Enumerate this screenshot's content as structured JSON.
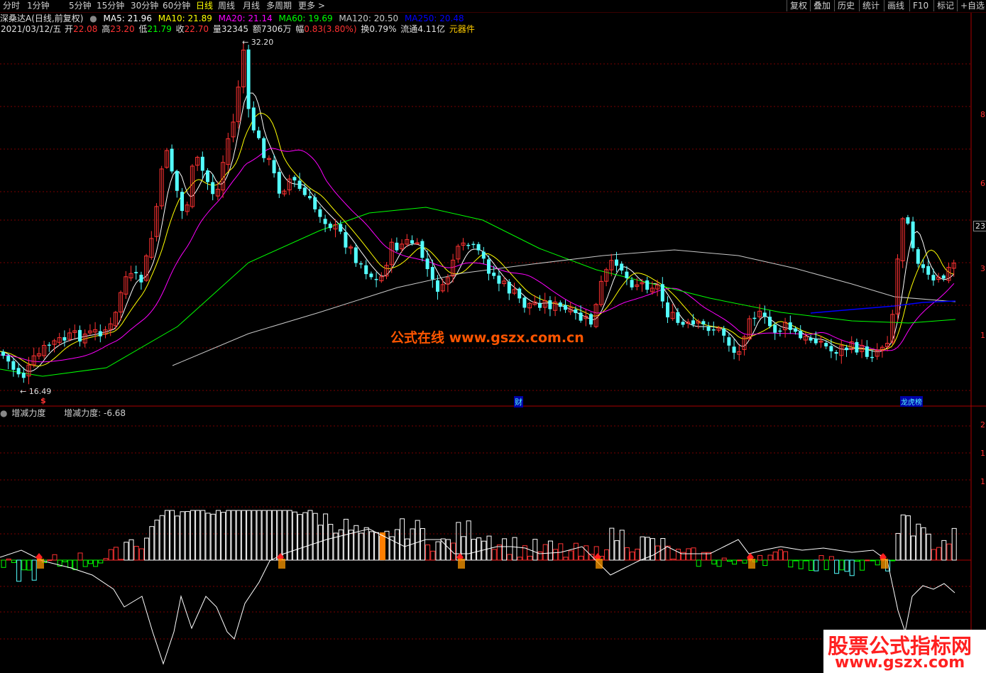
{
  "toolbar": {
    "periods": [
      "分时",
      "1分钟",
      "5分钟",
      "15分钟",
      "30分钟",
      "60分钟",
      "日线",
      "周线",
      "月线",
      "多周期",
      "更多 >"
    ],
    "active_period": "日线",
    "right_buttons": [
      "复权",
      "叠加",
      "历史",
      "统计",
      "画线",
      "F10",
      "标记",
      "+自选"
    ]
  },
  "header": {
    "stock_name": "深桑达A",
    "mode": "(日线,前复权)",
    "ma": [
      {
        "label": "MA5: 21.96",
        "color": "#ffffff"
      },
      {
        "label": "MA10: 21.89",
        "color": "#ffff00"
      },
      {
        "label": "MA20: 21.14",
        "color": "#ff00ff"
      },
      {
        "label": "MA60: 19.69",
        "color": "#00ff00"
      },
      {
        "label": "MA120: 20.50",
        "color": "#c8c8c8"
      },
      {
        "label": "MA250: 20.48",
        "color": "#0000ff"
      }
    ],
    "date": "2021/03/12/五",
    "open_label": "开",
    "open": "22.08",
    "high_label": "高",
    "high": "23.20",
    "low_label": "低",
    "low": "21.79",
    "close_label": "收",
    "close": "22.70",
    "vol_label": "量",
    "vol": "32345",
    "amount_label": "额",
    "amount": "7306万",
    "range_label": "幅",
    "range": "0.83(3.80%)",
    "turnover_label": "换",
    "turnover": "0.79%",
    "float_label": "流通",
    "float": "4.11亿",
    "tool": "元器件"
  },
  "main_chart": {
    "high_mark": "32.20",
    "low_mark": "16.49",
    "right_axis": [
      "8",
      "6",
      "23.",
      "3",
      "1"
    ],
    "right_price_tag": "23.",
    "event_marks": [
      "$",
      "财",
      "龙虎榜"
    ]
  },
  "indicator": {
    "name": "增减力度",
    "value_label": "增减力度: -6.68",
    "right_axis": [
      "2",
      "1",
      "1"
    ]
  },
  "watermarks": {
    "center": "公式在线 www.gszx.com.cn",
    "corner_title": "股票公式指标网",
    "corner_url": "www.gszx.com"
  },
  "colors": {
    "up": "#ff3232",
    "down": "#54ffff",
    "grid": "#7a0000",
    "ma5": "#ffffff",
    "ma10": "#ffff00",
    "ma20": "#ff00ff",
    "ma60": "#00ff00",
    "ma120": "#c8c8c8",
    "ma250": "#0000ff"
  }
}
